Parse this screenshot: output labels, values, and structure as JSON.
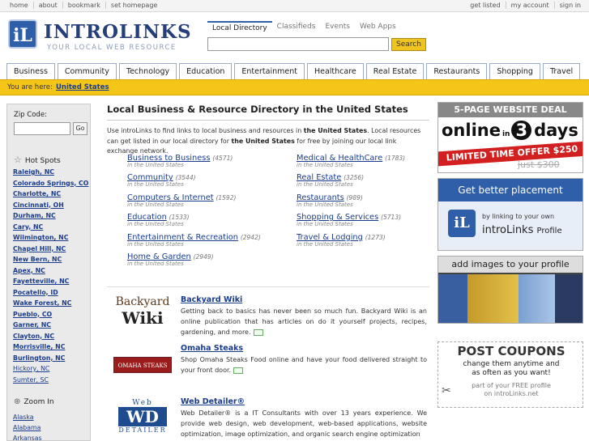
{
  "topbar": {
    "left": [
      "home",
      "about",
      "bookmark",
      "set homepage"
    ],
    "right": [
      "get listed",
      "my account",
      "sign in"
    ]
  },
  "logo": {
    "mark": "iL",
    "name": "INTROLINKS",
    "tagline": "YOUR LOCAL WEB RESOURCE"
  },
  "search": {
    "tabs": [
      "Local Directory",
      "Classifieds",
      "Events",
      "Web Apps"
    ],
    "active": "Local Directory",
    "value": "",
    "button": "Search"
  },
  "nav": [
    "Business",
    "Community",
    "Technology",
    "Education",
    "Entertainment",
    "Healthcare",
    "Real Estate",
    "Restaurants",
    "Shopping",
    "Travel"
  ],
  "breadcrumb": {
    "label": "You are here:",
    "value": "United States"
  },
  "sidebar": {
    "zip_label": "Zip Code:",
    "zip_value": "",
    "go": "Go",
    "hotspots_title": "Hot Spots",
    "hotspots": [
      "Raleigh, NC",
      "Colorado Springs, CO",
      "Charlotte, NC",
      "Cincinnati, OH",
      "Durham, NC",
      "Cary, NC",
      "Wilmington, NC",
      "Chapel Hill, NC",
      "New Bern, NC",
      "Apex, NC",
      "Fayetteville, NC",
      "Pocatello, ID",
      "Wake Forest, NC",
      "Pueblo, CO",
      "Garner, NC",
      "Clayton, NC",
      "Morrisville, NC",
      "Burlington, NC",
      "Hickory, NC",
      "Sumter, SC"
    ],
    "zoom_title": "Zoom In",
    "zoom": [
      "Alaska",
      "Alabama",
      "Arkansas"
    ]
  },
  "main": {
    "title": "Local Business & Resource Directory in the United States",
    "intro": {
      "p1": "Use introLinks to find links to local business and resources in ",
      "b1": "the United States",
      "p2": ". Local resources can get listed in our local directory for ",
      "b2": "the United States",
      "p3": " for free by joining our local link exchange network."
    },
    "categories": [
      {
        "name": "Business to Business",
        "count": "(4571)",
        "sub": "in the United States"
      },
      {
        "name": "Community",
        "count": "(3544)",
        "sub": "in the United States"
      },
      {
        "name": "Computers & Internet",
        "count": "(1592)",
        "sub": "in the United States"
      },
      {
        "name": "Education",
        "count": "(1533)",
        "sub": "in the United States"
      },
      {
        "name": "Entertainment & Recreation",
        "count": "(2942)",
        "sub": "in the United States"
      },
      {
        "name": "Home & Garden",
        "count": "(2949)",
        "sub": "in the United States"
      },
      {
        "name": "Medical & HealthCare",
        "count": "(1783)",
        "sub": "in the United States"
      },
      {
        "name": "Real Estate",
        "count": "(3256)",
        "sub": "in the United States"
      },
      {
        "name": "Restaurants",
        "count": "(989)",
        "sub": "in the United States"
      },
      {
        "name": "Shopping & Services",
        "count": "(5713)",
        "sub": "in the United States"
      },
      {
        "name": "Travel & Lodging",
        "count": "(1273)",
        "sub": "in the United States"
      }
    ],
    "listings": [
      {
        "title": "Backyard Wiki",
        "desc": "Getting back to basics has never been so much fun. Backyard Wiki is an online publication that has articles on do it yourself projects, recipes, gardening, and more.",
        "logo1": "Backyard",
        "logo2": "Wiki"
      },
      {
        "title": "Omaha Steaks",
        "desc": "Shop Omaha Steaks Food online and have your food delivered straight to your front door.",
        "logo1": "OMAHA STEAKS"
      },
      {
        "title": "Web Detailer®",
        "desc": "Web Detailer® is a IT Consultants with over 13 years experience. We provide web design, web development, web-based applications, website optimization, image optimization, and organic search engine optimization",
        "logo1": "Web",
        "logo2": "WD",
        "logo3": "DETAILER"
      }
    ]
  },
  "ads": [
    {
      "head": "5-PAGE WEBSITE DEAL",
      "l1": "online",
      "l2": "in",
      "l3": "3",
      "l4": "days",
      "strip": "LIMITED TIME OFFER $250",
      "faint": "just $300"
    },
    {
      "head": "Get better placement",
      "small": "by linking to your own",
      "brand": "introLinks",
      "brand2": "Profile",
      "mark": "iL"
    },
    {
      "head": "add images to your profile"
    },
    {
      "head": "POST COUPONS",
      "l1": "change them anytime and",
      "l2": "as often as you want!",
      "l3": "part of your FREE profile",
      "l4": "on introLinks.net"
    }
  ]
}
